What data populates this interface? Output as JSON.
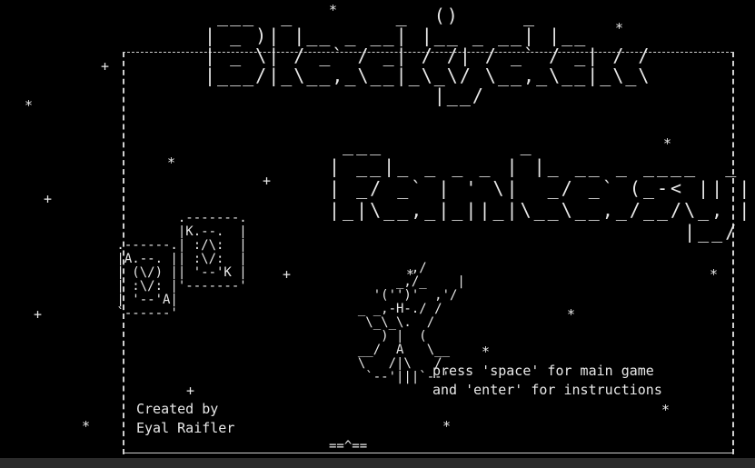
{
  "title": {
    "line1": "Blackjack",
    "line2": "Fantasy"
  },
  "prompt": {
    "line1": "press 'space' for main game",
    "line2": "and 'enter' for instructions"
  },
  "credit": {
    "line1": "Created by",
    "line2": "Eyal Raifler"
  },
  "cards": {
    "front_rank": "A",
    "back_rank": "K"
  },
  "bottom_mark": "==^==",
  "colors": {
    "background": "#000000",
    "foreground": "#e8e8e8",
    "statusbar": "#2b2b2b"
  }
}
